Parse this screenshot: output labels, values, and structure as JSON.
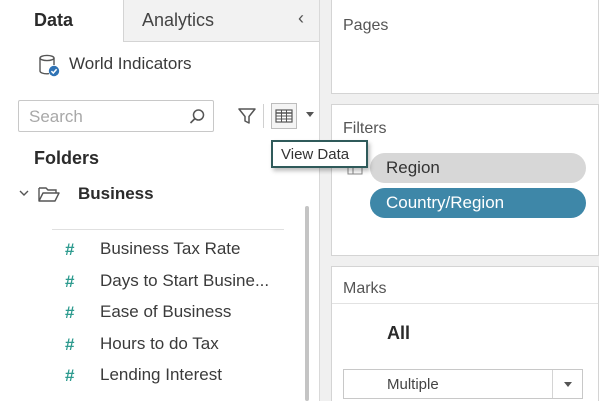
{
  "tabs": {
    "data": "Data",
    "analytics": "Analytics",
    "collapse_icon": "chevron-left-icon"
  },
  "datasource": {
    "name": "World Indicators",
    "icon": "database-check-icon"
  },
  "search": {
    "placeholder": "Search",
    "value": ""
  },
  "toolbar": {
    "search_icon": "search-icon",
    "filter_icon": "filter-funnel-icon",
    "view_data_icon": "view-data-grid-icon",
    "menu_icon": "caret-down-icon"
  },
  "tooltip": {
    "text": "View Data"
  },
  "folders": {
    "title": "Folders",
    "folder": {
      "name": "Business",
      "expanded": true
    },
    "fields": [
      {
        "name": "Business Tax Rate",
        "type_symbol": "#"
      },
      {
        "name": "Days to Start Busine...",
        "type_symbol": "#"
      },
      {
        "name": "Ease of Business",
        "type_symbol": "#"
      },
      {
        "name": "Hours to do Tax",
        "type_symbol": "#"
      },
      {
        "name": "Lending Interest",
        "type_symbol": "#"
      }
    ]
  },
  "shelves": {
    "pages": {
      "title": "Pages"
    },
    "filters": {
      "title": "Filters",
      "pills": [
        {
          "label": "Region"
        },
        {
          "label": "Country/Region"
        }
      ]
    },
    "marks": {
      "title": "Marks",
      "all_label": "All",
      "mark_type": "Multiple"
    }
  },
  "colors": {
    "measure_green": "#2e9b8f",
    "filter_pill_blue": "#3e87a8",
    "filter_pill_gray": "#d7d7d7",
    "tooltip_border": "#2f5a5a"
  }
}
